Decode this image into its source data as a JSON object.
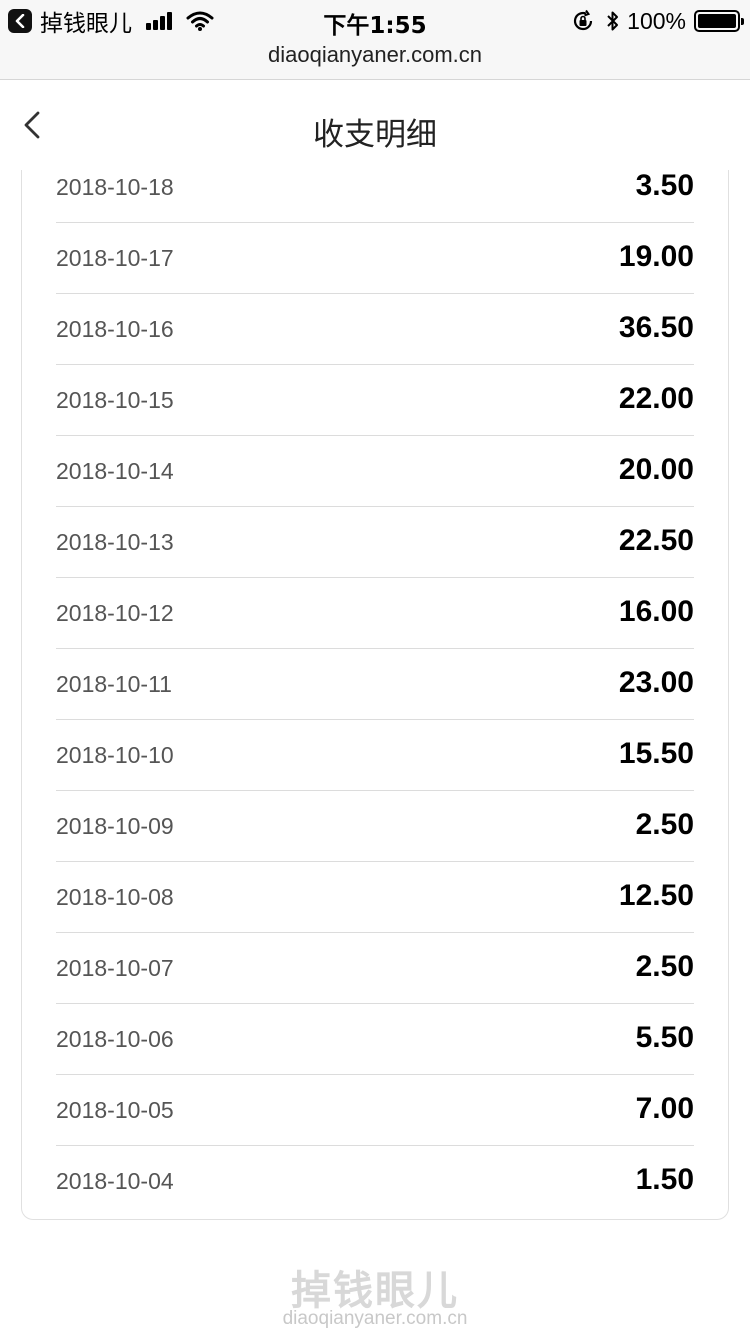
{
  "status_bar": {
    "app_name": "掉钱眼儿",
    "time": "下午1:55",
    "battery": "100%",
    "battery_level": 1.0,
    "url": "diaoqianyaner.com.cn",
    "icons": [
      "back-to-app-icon",
      "signal-icon",
      "wifi-icon",
      "orientation-lock-icon",
      "bluetooth-icon",
      "battery-icon"
    ]
  },
  "nav": {
    "title": "收支明细",
    "back_icon": "chevron-left-icon"
  },
  "records": [
    {
      "date": "2018-10-18",
      "amount": "3.50"
    },
    {
      "date": "2018-10-17",
      "amount": "19.00"
    },
    {
      "date": "2018-10-16",
      "amount": "36.50"
    },
    {
      "date": "2018-10-15",
      "amount": "22.00"
    },
    {
      "date": "2018-10-14",
      "amount": "20.00"
    },
    {
      "date": "2018-10-13",
      "amount": "22.50"
    },
    {
      "date": "2018-10-12",
      "amount": "16.00"
    },
    {
      "date": "2018-10-11",
      "amount": "23.00"
    },
    {
      "date": "2018-10-10",
      "amount": "15.50"
    },
    {
      "date": "2018-10-09",
      "amount": "2.50"
    },
    {
      "date": "2018-10-08",
      "amount": "12.50"
    },
    {
      "date": "2018-10-07",
      "amount": "2.50"
    },
    {
      "date": "2018-10-06",
      "amount": "5.50"
    },
    {
      "date": "2018-10-05",
      "amount": "7.00"
    },
    {
      "date": "2018-10-04",
      "amount": "1.50"
    }
  ],
  "footer": {
    "logo_text": "掉钱眼儿",
    "url": "diaoqianyaner.com.cn"
  }
}
